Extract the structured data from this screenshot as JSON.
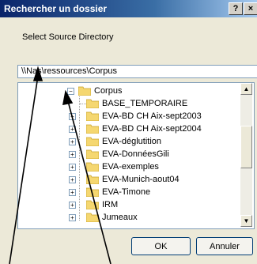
{
  "window": {
    "title": "Rechercher un dossier",
    "help_label": "?",
    "close_label": "×"
  },
  "dialog": {
    "prompt": "Select Source Directory",
    "path_value": "\\\\Nas\\ressources\\Corpus"
  },
  "tree": {
    "root": {
      "label": "Corpus",
      "expanded": true
    },
    "children": [
      {
        "label": "BASE_TEMPORAIRE",
        "expandable": false
      },
      {
        "label": "EVA-BD CH Aix-sept2003",
        "expandable": true
      },
      {
        "label": "EVA-BD CH Aix-sept2004",
        "expandable": true
      },
      {
        "label": "EVA-déglutition",
        "expandable": true
      },
      {
        "label": "EVA-DonnéesGili",
        "expandable": true
      },
      {
        "label": "EVA-exemples",
        "expandable": true
      },
      {
        "label": "EVA-Munich-aout04",
        "expandable": true
      },
      {
        "label": "EVA-Timone",
        "expandable": true
      },
      {
        "label": "IRM",
        "expandable": true
      },
      {
        "label": "Jumeaux",
        "expandable": true
      }
    ]
  },
  "buttons": {
    "ok_label": "OK",
    "cancel_label": "Annuler"
  },
  "colors": {
    "title_bar": "#0a246a",
    "folder": "#f5d770",
    "dialog_bg": "#ece9d8"
  }
}
